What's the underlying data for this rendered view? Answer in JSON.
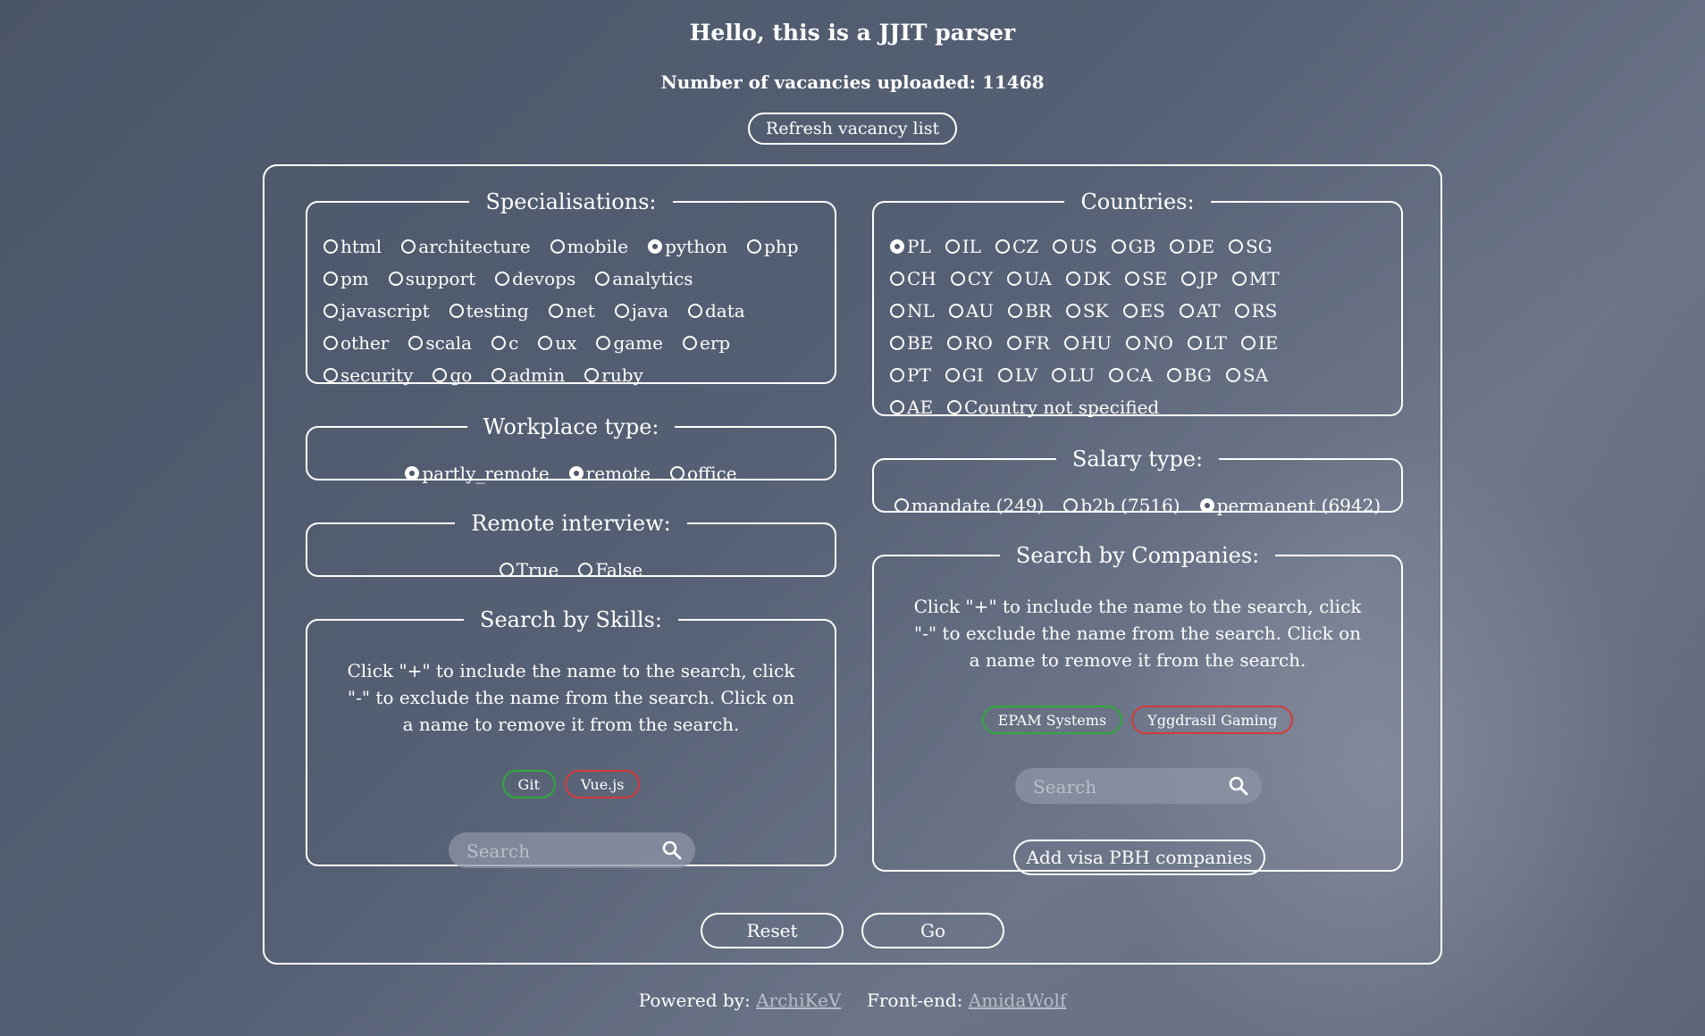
{
  "header": {
    "title": "Hello, this is a JJIT parser",
    "subtitle": "Number of vacancies uploaded: 11468",
    "refresh_label": "Refresh vacancy list"
  },
  "specialisations": {
    "legend": "Specialisations:",
    "rows": [
      [
        {
          "label": "html",
          "checked": false
        },
        {
          "label": "architecture",
          "checked": false
        },
        {
          "label": "mobile",
          "checked": false
        },
        {
          "label": "python",
          "checked": true
        },
        {
          "label": "php",
          "checked": false
        }
      ],
      [
        {
          "label": "pm",
          "checked": false
        },
        {
          "label": "support",
          "checked": false
        },
        {
          "label": "devops",
          "checked": false
        },
        {
          "label": "analytics",
          "checked": false
        }
      ],
      [
        {
          "label": "javascript",
          "checked": false
        },
        {
          "label": "testing",
          "checked": false
        },
        {
          "label": "net",
          "checked": false
        },
        {
          "label": "java",
          "checked": false
        },
        {
          "label": "data",
          "checked": false
        }
      ],
      [
        {
          "label": "other",
          "checked": false
        },
        {
          "label": "scala",
          "checked": false
        },
        {
          "label": "c",
          "checked": false
        },
        {
          "label": "ux",
          "checked": false
        },
        {
          "label": "game",
          "checked": false
        },
        {
          "label": "erp",
          "checked": false
        }
      ],
      [
        {
          "label": "security",
          "checked": false
        },
        {
          "label": "go",
          "checked": false
        },
        {
          "label": "admin",
          "checked": false
        },
        {
          "label": "ruby",
          "checked": false
        }
      ]
    ]
  },
  "countries": {
    "legend": "Countries:",
    "rows": [
      [
        {
          "label": "PL",
          "checked": true
        },
        {
          "label": "IL",
          "checked": false
        },
        {
          "label": "CZ",
          "checked": false
        },
        {
          "label": "US",
          "checked": false
        },
        {
          "label": "GB",
          "checked": false
        },
        {
          "label": "DE",
          "checked": false
        },
        {
          "label": "SG",
          "checked": false
        }
      ],
      [
        {
          "label": "CH",
          "checked": false
        },
        {
          "label": "CY",
          "checked": false
        },
        {
          "label": "UA",
          "checked": false
        },
        {
          "label": "DK",
          "checked": false
        },
        {
          "label": "SE",
          "checked": false
        },
        {
          "label": "JP",
          "checked": false
        },
        {
          "label": "MT",
          "checked": false
        }
      ],
      [
        {
          "label": "NL",
          "checked": false
        },
        {
          "label": "AU",
          "checked": false
        },
        {
          "label": "BR",
          "checked": false
        },
        {
          "label": "SK",
          "checked": false
        },
        {
          "label": "ES",
          "checked": false
        },
        {
          "label": "AT",
          "checked": false
        },
        {
          "label": "RS",
          "checked": false
        }
      ],
      [
        {
          "label": "BE",
          "checked": false
        },
        {
          "label": "RO",
          "checked": false
        },
        {
          "label": "FR",
          "checked": false
        },
        {
          "label": "HU",
          "checked": false
        },
        {
          "label": "NO",
          "checked": false
        },
        {
          "label": "LT",
          "checked": false
        },
        {
          "label": "IE",
          "checked": false
        }
      ],
      [
        {
          "label": "PT",
          "checked": false
        },
        {
          "label": "GI",
          "checked": false
        },
        {
          "label": "LV",
          "checked": false
        },
        {
          "label": "LU",
          "checked": false
        },
        {
          "label": "CA",
          "checked": false
        },
        {
          "label": "BG",
          "checked": false
        },
        {
          "label": "SA",
          "checked": false
        }
      ],
      [
        {
          "label": "AE",
          "checked": false
        },
        {
          "label": "Country not specified",
          "checked": false
        }
      ]
    ]
  },
  "workplace": {
    "legend": "Workplace type:",
    "options": [
      {
        "label": "partly_remote",
        "checked": true
      },
      {
        "label": "remote",
        "checked": true
      },
      {
        "label": "office",
        "checked": false
      }
    ]
  },
  "salary": {
    "legend": "Salary type:",
    "options": [
      {
        "label": "mandate (249)",
        "checked": false
      },
      {
        "label": "b2b (7516)",
        "checked": false
      },
      {
        "label": "permanent (6942)",
        "checked": true
      }
    ]
  },
  "remote_interview": {
    "legend": "Remote interview:",
    "options": [
      {
        "label": "True",
        "checked": false
      },
      {
        "label": "False",
        "checked": false
      }
    ]
  },
  "skills": {
    "legend": "Search by Skills:",
    "description": "Click \"+\" to include the name to the search, click \"-\" to exclude the name from the search. Click on a name to remove it from the search.",
    "tags": [
      {
        "label": "Git",
        "mode": "include"
      },
      {
        "label": "Vue.js",
        "mode": "exclude"
      }
    ],
    "search_placeholder": "Search"
  },
  "companies": {
    "legend": "Search by Companies:",
    "description": "Click \"+\" to include the name to the search, click \"-\" to exclude the name from the search. Click on a name to remove it from the search.",
    "tags": [
      {
        "label": "EPAM Systems",
        "mode": "include"
      },
      {
        "label": "Yggdrasil Gaming",
        "mode": "exclude"
      }
    ],
    "search_placeholder": "Search",
    "visa_button": "Add visa PBH companies"
  },
  "actions": {
    "reset": "Reset",
    "go": "Go"
  },
  "footer": {
    "powered_prefix": "Powered by:",
    "powered_name": "ArchiKeV",
    "frontend_prefix": "Front-end:",
    "frontend_name": "AmidaWolf"
  },
  "colors": {
    "include": "#2eaa3c",
    "exclude": "#d63a3a",
    "background": "#4f586c"
  }
}
